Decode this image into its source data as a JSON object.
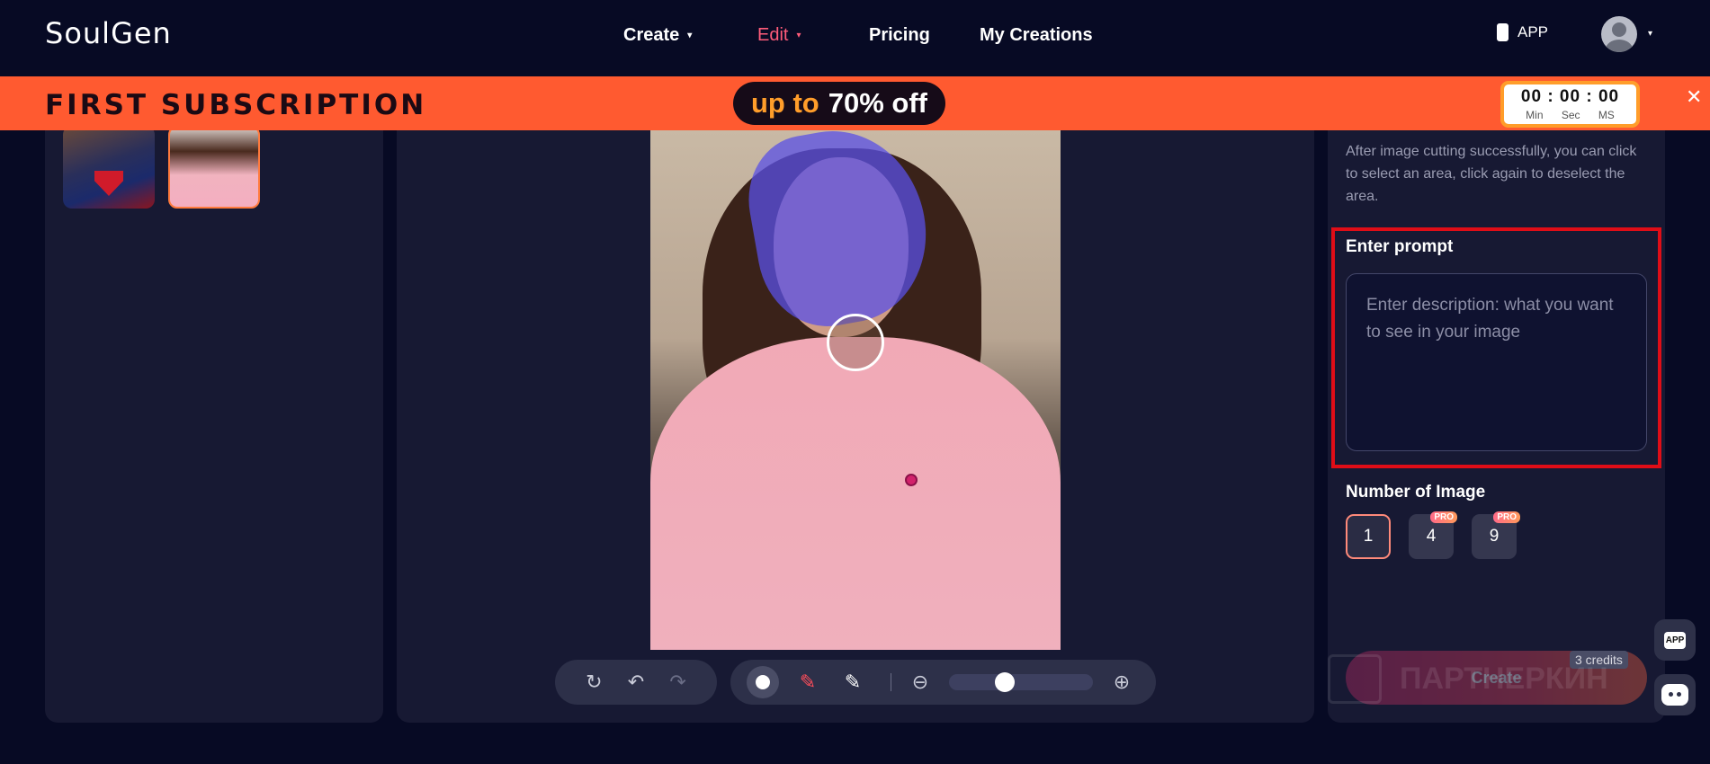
{
  "header": {
    "logo": "SoulGen",
    "nav": [
      {
        "label": "Create",
        "caret": "▾"
      },
      {
        "label": "Edit",
        "caret": "▾"
      },
      {
        "label": "Pricing"
      },
      {
        "label": "My Creations"
      }
    ],
    "app_label": "APP",
    "avatar_caret": "▾",
    "accent_color": "#ff5c7a"
  },
  "promo": {
    "title": "FIRST SUBSCRIPTION",
    "pill_part_a": "up to",
    "pill_part_b": "70% off",
    "timer_digits": "00 : 00 : 00",
    "timer_units": [
      "Min",
      "Sec",
      "MS"
    ],
    "close_icon": "✕",
    "background_color": "#ff5a30"
  },
  "toolbar": {
    "rotate_icon": "↻",
    "undo_icon": "↶",
    "redo_icon": "↷",
    "zoom_out_icon": "⊖",
    "zoom_in_icon": "⊕",
    "brush_add_icon": "✎",
    "brush_sub_icon": "✎",
    "zoom_level": 0.37
  },
  "right_panel": {
    "hint": "After image cutting successfully, you can click to select an area, click again to deselect the area.",
    "prompt_label": "Enter prompt",
    "prompt_placeholder": "Enter description: what you want to see in your image",
    "prompt_value": "",
    "count_label": "Number of Image",
    "counts": [
      {
        "value": "1",
        "pro": false,
        "selected": true
      },
      {
        "value": "4",
        "pro": true,
        "badge": "PRO"
      },
      {
        "value": "9",
        "pro": true,
        "badge": "PRO"
      }
    ],
    "create_label": "Create",
    "credits": "3 credits",
    "watermark": "ПАРТНЕРКИН"
  },
  "side": {
    "app_badge": "APP"
  }
}
